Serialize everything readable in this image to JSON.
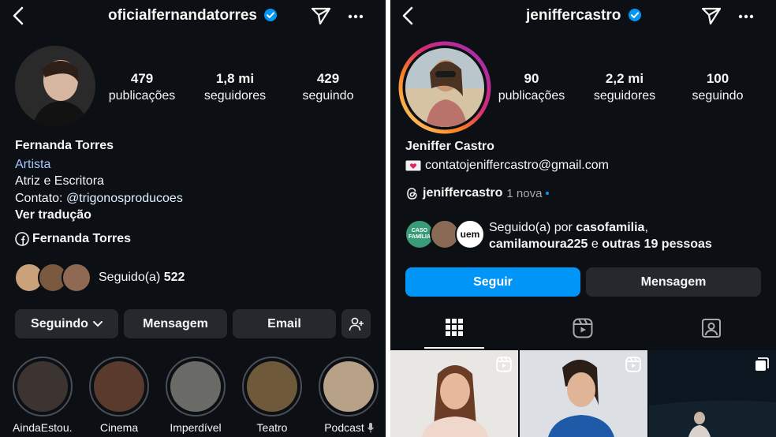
{
  "left": {
    "username": "oficialfernandatorres",
    "stats": [
      {
        "value": "479",
        "label": "publicações"
      },
      {
        "value": "1,8 mi",
        "label": "seguidores"
      },
      {
        "value": "429",
        "label": "seguindo"
      }
    ],
    "name": "Fernanda Torres",
    "category": "Artista",
    "bio_line": "Atriz e Escritora",
    "contact_prefix": "Contato: ",
    "contact_handle": "@trigonosproducoes",
    "see_translation": "Ver tradução",
    "facebook_link": "Fernanda Torres",
    "followed_by_prefix": "Seguido(a) ",
    "followed_by_count": "522",
    "buttons": {
      "following": "Seguindo",
      "message": "Mensagem",
      "email": "Email"
    },
    "highlights": [
      "AindaEstou...",
      "Cinema",
      "Imperdível",
      "Teatro",
      "Podcast"
    ]
  },
  "right": {
    "username": "jeniffercastro",
    "stats": [
      {
        "value": "90",
        "label": "publicações"
      },
      {
        "value": "2,2 mi",
        "label": "seguidores"
      },
      {
        "value": "100",
        "label": "seguindo"
      }
    ],
    "name": "Jeniffer Castro",
    "email": "contatojeniffercastro@gmail.com",
    "threads_handle": "jeniffercastro",
    "threads_new": "1 nova",
    "followed_by_prefix": "Seguido(a) por ",
    "followed_by_user1": "casofamilia",
    "followed_by_user2": "camilamoura225",
    "followed_by_mid": " e ",
    "followed_by_rest": "outras 19 pessoas",
    "mini_avatar_texts": [
      "CASO FAMÍLIA",
      "uem"
    ],
    "buttons": {
      "follow": "Seguir",
      "message": "Mensagem"
    }
  },
  "colors": {
    "background": "#0c1014",
    "button": "#25292e",
    "link": "#e0f1ff",
    "category": "#a8c7fa",
    "follow": "#0095f6",
    "verified": "#0095f6",
    "secondary": "#a8a8a8"
  }
}
